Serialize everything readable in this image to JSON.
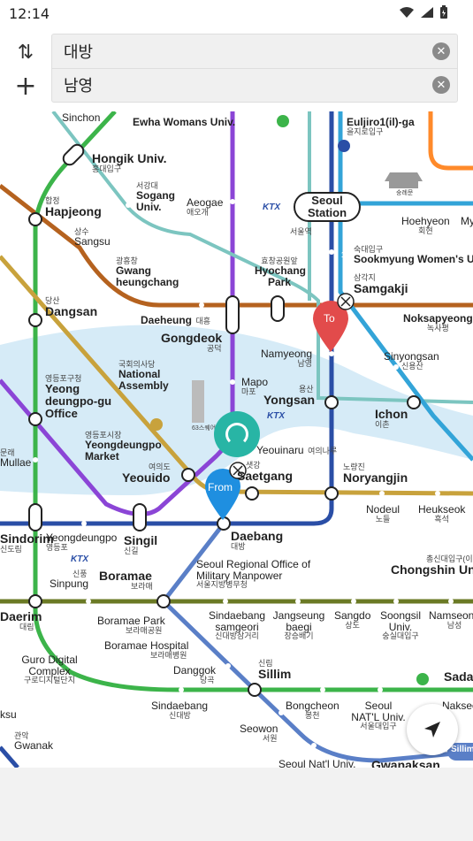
{
  "status": {
    "time": "12:14"
  },
  "route": {
    "from_value": "대방",
    "to_value": "남영",
    "clear_from": "✕",
    "clear_to": "✕",
    "swap_icon": "⇅",
    "add_icon": "+"
  },
  "map": {
    "stations": [
      {
        "id": "sinchon",
        "en": "Sinchon",
        "ko": ""
      },
      {
        "id": "ewha",
        "en": "Ewha Womans Univ.",
        "ko": "이대"
      },
      {
        "id": "euljiro1",
        "en": "Euljiro1(il)-ga",
        "ko": "을지로입구"
      },
      {
        "id": "hongik",
        "en": "Hongik Univ.",
        "ko": "홍대입구"
      },
      {
        "id": "sogang",
        "en": "Sogang Univ.",
        "ko": "서강대"
      },
      {
        "id": "hapjeong",
        "en": "Hapjeong",
        "ko": "합정"
      },
      {
        "id": "aeogae",
        "en": "Aeogae",
        "ko": "애오개"
      },
      {
        "id": "seoul",
        "en": "Seoul Station",
        "ko": "서울역"
      },
      {
        "id": "hoehyeon",
        "en": "Hoehyeon",
        "ko": "회현"
      },
      {
        "id": "my",
        "en": "My",
        "ko": ""
      },
      {
        "id": "sangsu",
        "en": "Sangsu",
        "ko": "상수"
      },
      {
        "id": "gwangheung",
        "en": "Gwang heungchang",
        "ko": "광흥창"
      },
      {
        "id": "hyochang",
        "en": "Hyochang Park",
        "ko": "효창공원앞"
      },
      {
        "id": "sookmyung",
        "en": "Sookmyung Women's Ur",
        "ko": "숙대입구"
      },
      {
        "id": "samgakji",
        "en": "Samgakji",
        "ko": "삼각지"
      },
      {
        "id": "dangsan",
        "en": "Dangsan",
        "ko": "당산"
      },
      {
        "id": "daeheung",
        "en": "Daeheung",
        "ko": "대흥"
      },
      {
        "id": "gongdeok",
        "en": "Gongdeok",
        "ko": "공덕"
      },
      {
        "id": "noksapyeong",
        "en": "Noksapyeong",
        "ko": "녹사평"
      },
      {
        "id": "namyeong",
        "en": "Namyeong",
        "ko": "남영"
      },
      {
        "id": "sinyongsan",
        "en": "Sinyongsan",
        "ko": "신용산"
      },
      {
        "id": "assembly",
        "en": "National Assembly",
        "ko": "국회의사당"
      },
      {
        "id": "yeongdeungpogu",
        "en": "Yeong deungpo-gu Office",
        "ko": "영등포구청"
      },
      {
        "id": "mapo",
        "en": "Mapo",
        "ko": "마포"
      },
      {
        "id": "yongsan",
        "en": "Yongsan",
        "ko": "용산"
      },
      {
        "id": "ichon",
        "en": "Ichon",
        "ko": "이촌"
      },
      {
        "id": "yeongdeungpomarket",
        "en": "Yeongdeungpo Market",
        "ko": "영등포시장"
      },
      {
        "id": "yeouinaru",
        "en": "Yeouinaru",
        "ko": "여의나루"
      },
      {
        "id": "yeouido",
        "en": "Yeouido",
        "ko": "여의도"
      },
      {
        "id": "saetgang",
        "en": "Saetgang",
        "ko": "샛강"
      },
      {
        "id": "noryangjin",
        "en": "Noryangjin",
        "ko": "노량진"
      },
      {
        "id": "mullae",
        "en": "Mullae",
        "ko": "문래"
      },
      {
        "id": "nodeul",
        "en": "Nodeul",
        "ko": "노들"
      },
      {
        "id": "heukseok",
        "en": "Heukseok",
        "ko": "흑석"
      },
      {
        "id": "sindorim",
        "en": "Sindorim",
        "ko": "신도림"
      },
      {
        "id": "yeongdeungpo",
        "en": "Yeongdeungpo",
        "ko": "영등포"
      },
      {
        "id": "singil",
        "en": "Singil",
        "ko": "신길"
      },
      {
        "id": "daebang",
        "en": "Daebang",
        "ko": "대방"
      },
      {
        "id": "manpower",
        "en": "Seoul Regional Office of Military Manpower",
        "ko": "서울지방병무청"
      },
      {
        "id": "sinpung",
        "en": "Sinpung",
        "ko": "신풍"
      },
      {
        "id": "boramae",
        "en": "Boramae",
        "ko": "보라매"
      },
      {
        "id": "chongshin",
        "en": "Chongshin Uni",
        "ko": "총신대입구(이"
      },
      {
        "id": "daerim",
        "en": "Daerim",
        "ko": "대림"
      },
      {
        "id": "boramaepark",
        "en": "Boramae Park",
        "ko": "보라매공원"
      },
      {
        "id": "sindaebang3",
        "en": "Sindaebang samgeori",
        "ko": "신대방삼거리"
      },
      {
        "id": "jangseungbaegi",
        "en": "Jangseung baegi",
        "ko": "장승배기"
      },
      {
        "id": "sangdo",
        "en": "Sangdo",
        "ko": "상도"
      },
      {
        "id": "soongsil",
        "en": "Soongsil Univ.",
        "ko": "숭실대입구"
      },
      {
        "id": "namseong",
        "en": "Namseong",
        "ko": "남성"
      },
      {
        "id": "boramaehospital",
        "en": "Boramae Hospital",
        "ko": "보라매병원"
      },
      {
        "id": "guro",
        "en": "Guro Digital Complex",
        "ko": "구로디지털단지"
      },
      {
        "id": "danggok",
        "en": "Danggok",
        "ko": "당곡"
      },
      {
        "id": "sillim",
        "en": "Sillim",
        "ko": "신림"
      },
      {
        "id": "sadang",
        "en": "Sada",
        "ko": ""
      },
      {
        "id": "sindaebang",
        "en": "Sindaebang",
        "ko": "신대방"
      },
      {
        "id": "bongcheon",
        "en": "Bongcheon",
        "ko": "봉천"
      },
      {
        "id": "snuniv",
        "en": "Seoul NAT'L Univ.",
        "ko": "서울대입구"
      },
      {
        "id": "nakseongdae",
        "en": "Nakseongdae",
        "ko": ""
      },
      {
        "id": "guksu",
        "en": "ksu",
        "ko": ""
      },
      {
        "id": "gwanak",
        "en": "Gwanak",
        "ko": "관악"
      },
      {
        "id": "seowon",
        "en": "Seowon",
        "ko": "서원"
      },
      {
        "id": "snuniv2",
        "en": "Seoul Nat'l Univ.",
        "ko": ""
      },
      {
        "id": "gwanaksan",
        "en": "Gwanaksan",
        "ko": ""
      }
    ],
    "badges": {
      "line1": "1",
      "line2": "2",
      "line9": "9",
      "ktx": "KTX",
      "sillim_line": "Sillim"
    },
    "landmarks": {
      "sungnyemun": "숭례문",
      "tower63": "63스퀘어"
    },
    "pins": {
      "from": "From",
      "to": "To"
    },
    "colors": {
      "line1": "#2a4ea6",
      "line2": "#3cb44a",
      "line4": "#33a4d8",
      "line5": "#8b45d6",
      "line6": "#b5621f",
      "line9": "#c8a23c",
      "gyeongui": "#7cc5c0",
      "sillimline": "#5a7fc7",
      "line2orange": "#ff8a2a",
      "line7": "#6b7a25",
      "river": "#d6ebf7",
      "pin_from": "#1f8fe0",
      "pin_to": "#e24b4b",
      "loading": "#28b5a5"
    }
  }
}
